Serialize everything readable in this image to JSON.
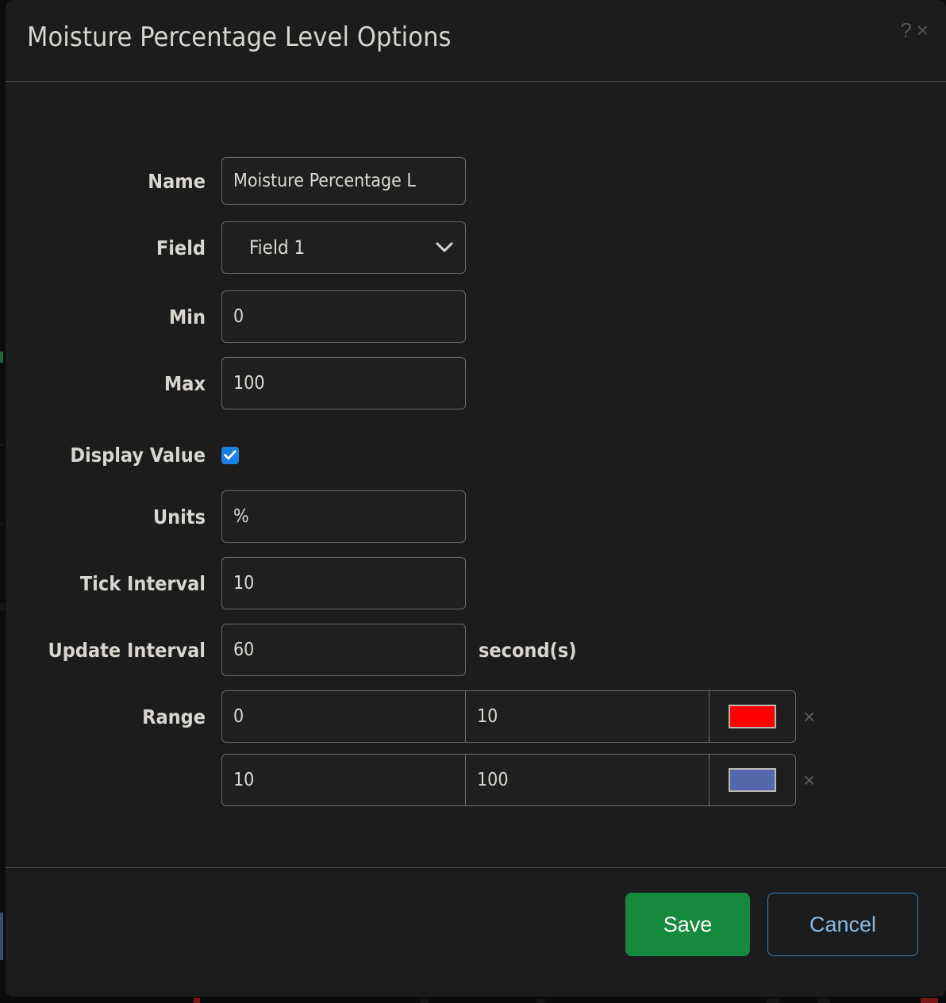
{
  "dialog": {
    "title": "Moisture Percentage Level Options",
    "help_icon_label": "?",
    "close_icon_label": "×"
  },
  "form": {
    "name": {
      "label": "Name",
      "value": "Moisture Percentage L",
      "placeholder": ""
    },
    "field": {
      "label": "Field",
      "value": "Field 1",
      "options": [
        "Field 1"
      ]
    },
    "min": {
      "label": "Min",
      "value": "0",
      "placeholder": ""
    },
    "max": {
      "label": "Max",
      "value": "100",
      "placeholder": ""
    },
    "display_value": {
      "label": "Display Value",
      "checked": true
    },
    "units": {
      "label": "Units",
      "value": "%",
      "placeholder": ""
    },
    "tick_interval": {
      "label": "Tick Interval",
      "value": "10",
      "placeholder": ""
    },
    "update_interval": {
      "label": "Update Interval",
      "value": "60",
      "suffix": "second(s)",
      "placeholder": ""
    },
    "range": {
      "label": "Range",
      "rows": [
        {
          "from": "0",
          "to": "10",
          "color": "#FF0000",
          "remove_label": "×"
        },
        {
          "from": "10",
          "to": "100",
          "color": "#5566AA",
          "remove_label": "×"
        }
      ],
      "add_label": "+"
    }
  },
  "footer": {
    "save_label": "Save",
    "cancel_label": "Cancel"
  },
  "colors": {
    "modal_bg": "#1c1c1c",
    "accent_checkbox": "#1a80e8",
    "save_green": "#158a3e",
    "cancel_blue": "#86b9e3",
    "range_1": "#FF0000",
    "range_2": "#5566AA"
  }
}
